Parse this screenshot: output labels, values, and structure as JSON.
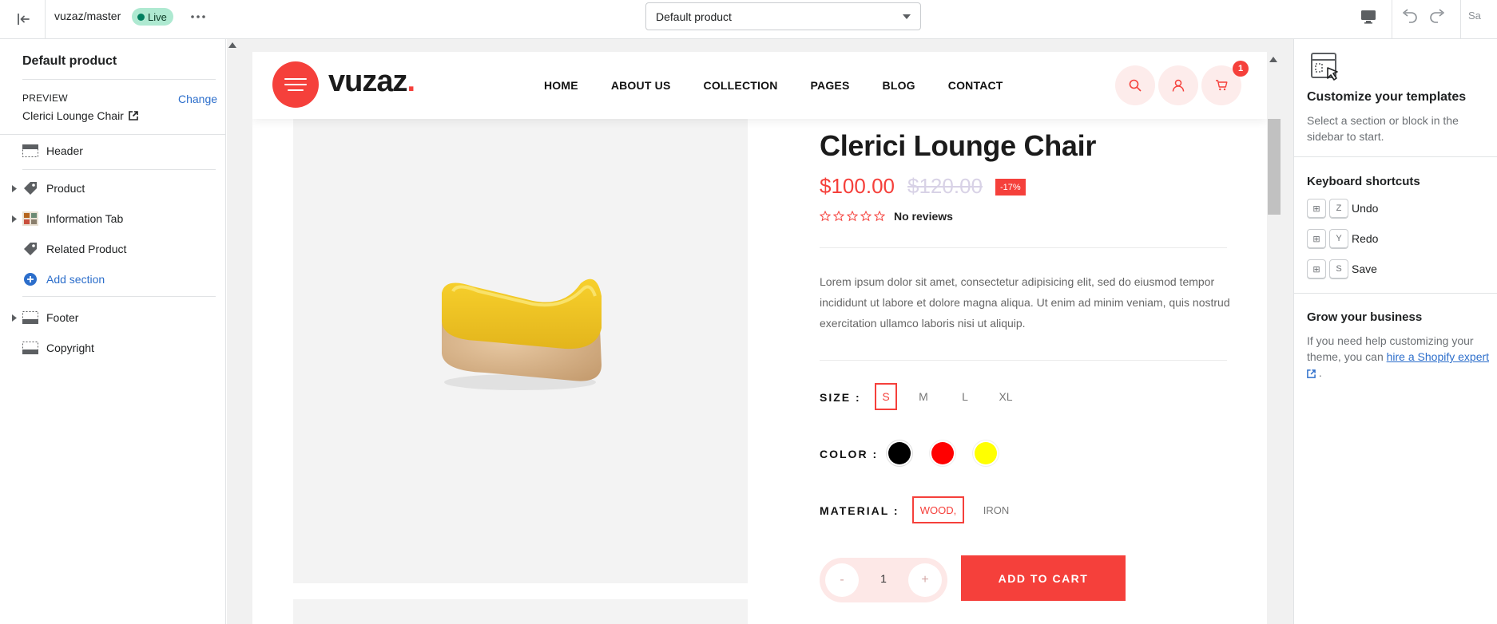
{
  "topbar": {
    "theme_name": "vuzaz/master",
    "status": "Live",
    "template_select": "Default product",
    "save_label": "Sa"
  },
  "left_sidebar": {
    "title": "Default product",
    "preview_label": "PREVIEW",
    "change_label": "Change",
    "preview_value": "Clerici Lounge Chair",
    "sections": [
      {
        "label": "Header",
        "icon": "header-layout-icon",
        "expandable": false
      },
      {
        "label": "Product",
        "icon": "tag-icon",
        "expandable": true
      },
      {
        "label": "Information Tab",
        "icon": "image-thumbnail-icon",
        "expandable": true
      },
      {
        "label": "Related Product",
        "icon": "tag-icon",
        "expandable": false
      }
    ],
    "add_section_label": "Add section",
    "footer_sections": [
      {
        "label": "Footer",
        "icon": "footer-layout-icon",
        "expandable": true
      },
      {
        "label": "Copyright",
        "icon": "footer-layout-icon",
        "expandable": false
      }
    ]
  },
  "store": {
    "logo_text": "vuzaz",
    "logo_dot": ".",
    "nav": [
      "HOME",
      "ABOUT US",
      "COLLECTION",
      "PAGES",
      "BLOG",
      "CONTACT"
    ],
    "cart_count": "1",
    "product": {
      "title": "Clerici Lounge Chair",
      "price": "$100.00",
      "compare_price": "$120.00",
      "discount": "-17%",
      "rating": 0,
      "reviews_label": "No reviews",
      "description": "Lorem ipsum dolor sit amet, consectetur adipisicing elit, sed do eiusmod tempor incididunt ut labore et dolore magna aliqua. Ut enim ad minim veniam, quis nostrud exercitation ullamco laboris nisi ut aliquip.",
      "size_label": "SIZE :",
      "sizes": [
        "S",
        "M",
        "L",
        "XL"
      ],
      "selected_size": "S",
      "color_label": "COLOR :",
      "colors": [
        "#000000",
        "#ff0000",
        "#ffff00"
      ],
      "material_label": "MATERIAL :",
      "materials": [
        "WOOD,",
        "IRON"
      ],
      "selected_material": "WOOD,",
      "qty_minus": "-",
      "qty_value": "1",
      "qty_plus": "+",
      "add_to_cart": "ADD TO CART"
    }
  },
  "right_sidebar": {
    "heading": "Customize your templates",
    "intro": "Select a section or block in the sidebar to start.",
    "shortcuts_heading": "Keyboard shortcuts",
    "shortcuts": [
      {
        "mod": "⊞",
        "key": "Z",
        "action": "Undo"
      },
      {
        "mod": "⊞",
        "key": "Y",
        "action": "Redo"
      },
      {
        "mod": "⊞",
        "key": "S",
        "action": "Save"
      }
    ],
    "grow_heading": "Grow your business",
    "grow_text": "If you need help customizing your theme, you can",
    "grow_link": "hire a Shopify expert",
    "grow_end": "."
  },
  "colors": {
    "brand": "#f5403b",
    "editor_link": "#2c6ecb",
    "live_badge": "#aee9d1"
  }
}
